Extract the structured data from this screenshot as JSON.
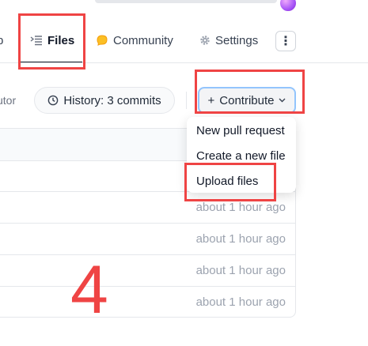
{
  "tabs": {
    "app_label": "p",
    "files_label": "Files",
    "community_label": "Community",
    "settings_label": "Settings",
    "more_label": "⋮"
  },
  "toolbar": {
    "contributor_text": "utor",
    "history_label": "History: 3 commits",
    "contribute_label": "Contribute",
    "contribute_prefix": "+"
  },
  "contribute_menu": {
    "items": [
      "New pull request",
      "Create a new file",
      "Upload files"
    ]
  },
  "file_rows": [
    {
      "time": ""
    },
    {
      "time": "about 1 hour ago"
    },
    {
      "time": "about 1 hour ago"
    },
    {
      "time": "about 1 hour ago"
    },
    {
      "time": "about 1 hour ago"
    }
  ],
  "annotation": {
    "step_number": "4",
    "highlight_color": "#ef4444"
  },
  "icons": {
    "files": "files-icon",
    "community": "community-icon",
    "settings": "gear-icon",
    "history": "clock-icon",
    "contribute": "chevron-down-icon"
  }
}
